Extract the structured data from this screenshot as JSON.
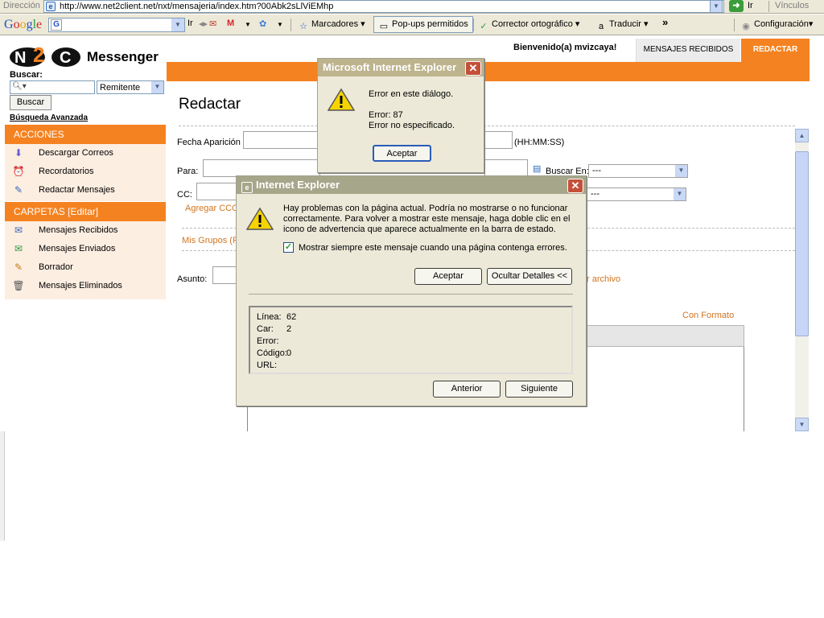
{
  "browser": {
    "address_label": "Dirección",
    "url": "http://www.net2client.net/nxt/mensajeria/index.htm?00Abk2sLlViEMhp",
    "go_label": "Ir",
    "links_label": "Vínculos"
  },
  "google_toolbar": {
    "logo": "Google",
    "go_label": "Ir",
    "bookmarks_label": "Marcadores",
    "popups_label": "Pop-ups permitidos",
    "spellcheck_label": "Corrector ortográfico",
    "translate_label": "Traducir",
    "more_label": "»",
    "settings_label": "Configuración"
  },
  "app": {
    "logo_text": "Messenger",
    "welcome": "Bienvenido(a) mvizcaya!",
    "tabs": [
      {
        "label": "MENSAJES RECIBIDOS"
      },
      {
        "label": "REDACTAR"
      }
    ]
  },
  "sidebar": {
    "search_label": "Buscar:",
    "search_value": "",
    "filter_value": "Remitente",
    "search_button": "Buscar",
    "advanced_search": "Búsqueda Avanzada",
    "actions_header": "ACCIONES",
    "actions": [
      {
        "label": "Descargar Correos",
        "icon": "download-icon"
      },
      {
        "label": "Recordatorios",
        "icon": "alarm-icon"
      },
      {
        "label": "Redactar Mensajes",
        "icon": "pencil-icon"
      }
    ],
    "folders_header": "CARPETAS [Editar]",
    "folders": [
      {
        "label": "Mensajes Recibidos",
        "icon": "inbox-icon"
      },
      {
        "label": "Mensajes Enviados",
        "icon": "sent-icon"
      },
      {
        "label": "Borrador",
        "icon": "draft-icon"
      },
      {
        "label": "Mensajes Eliminados",
        "icon": "trash-icon"
      }
    ]
  },
  "compose": {
    "title": "Redactar",
    "fecha_label": "Fecha Aparición",
    "time_format": "(HH:MM:SS)",
    "para_label": "Para:",
    "buscar_en_label": "Buscar En:",
    "buscar_en_value": "---",
    "cc_label": "CC:",
    "cc_select_value": "---",
    "agregar_cco": "Agregar CCO",
    "mis_grupos": "Mis Grupos (Pr",
    "asunto_label": "Asunto:",
    "archivo_link": "r archivo",
    "con_formato": "Con Formato"
  },
  "dialog_small": {
    "title": "Microsoft Internet Explorer",
    "line1": "Error en este diálogo.",
    "line2": "Error: 87",
    "line3": "Error no especificado.",
    "ok_button": "Aceptar"
  },
  "dialog_main": {
    "title": "Internet Explorer",
    "message": "Hay problemas con la página actual. Podría no mostrarse o no funcionar correctamente. Para volver a mostrar este mensaje, haga doble clic en el icono de advertencia que aparece actualmente en la barra de estado.",
    "message_lines": [
      "Hay problemas con la página actual. Podría no mostrarse o no funcionar",
      "correctamente. Para volver a mostrar este mensaje, haga doble clic en el",
      "icono de advertencia que aparece actualmente en la barra de estado."
    ],
    "checkbox_label": "Mostrar siempre este mensaje cuando una página contenga errores.",
    "checkbox_checked": true,
    "ok_button": "Aceptar",
    "details_button": "Ocultar Detalles <<",
    "details": [
      {
        "label": "Línea:",
        "value": "62"
      },
      {
        "label": "Car:",
        "value": "2"
      },
      {
        "label": "Error:",
        "value": ""
      },
      {
        "label": "Código:",
        "value": "0"
      },
      {
        "label": "URL:",
        "value": ""
      }
    ],
    "prev_button": "Anterior",
    "next_button": "Siguiente"
  },
  "colors": {
    "brand_orange": "#f58220",
    "sidebar_bg": "#fdeee2",
    "link_orange": "#d2741f"
  }
}
